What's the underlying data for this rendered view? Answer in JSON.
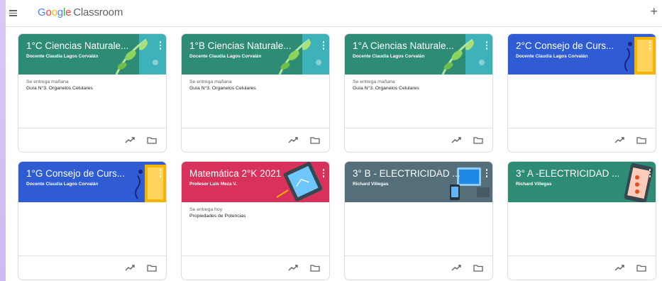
{
  "header": {
    "brand": {
      "g1": "G",
      "o1": "o",
      "o2": "o",
      "g2": "g",
      "l": "l",
      "e": "e",
      "product": "Classroom"
    },
    "add_label": "+"
  },
  "cards": [
    {
      "title": "1°C Ciencias Naturale...",
      "teacher": "Docente Claudia Lagos Corvalán",
      "color": "#2e8b74",
      "art": "leaf",
      "due": "Se entrega mañana",
      "assignment": "Guía N°3. Organelos Celulares"
    },
    {
      "title": "1°B Ciencias Naturale...",
      "teacher": "Docente Claudia Lagos Corvalán",
      "color": "#2e8b74",
      "art": "leaf",
      "due": "Se entrega mañana",
      "assignment": "Guía N°3. Organelos Celulares"
    },
    {
      "title": "1°A Ciencias Naturale...",
      "teacher": "Docente Claudia Lagos Corvalán",
      "color": "#2e8b74",
      "art": "leaf",
      "due": "Se entrega mañana",
      "assignment": "Guía N°3. Organelos Celulares"
    },
    {
      "title": "2°C Consejo de Curs...",
      "teacher": "Docente Claudia Lagos Corvalán",
      "color": "#2f5bd3",
      "art": "notebook",
      "due": "",
      "assignment": ""
    },
    {
      "title": "1°G Consejo de Curs...",
      "teacher": "Docente Claudia Lagos Corvalán",
      "color": "#2f5bd3",
      "art": "notebook",
      "due": "",
      "assignment": ""
    },
    {
      "title": "Matemática 2°K 2021",
      "teacher": "Profesor Luis Meza V.",
      "color": "#d8315b",
      "art": "tablet",
      "due": "Se entrega hoy",
      "assignment": "Propiedades de Potencias"
    },
    {
      "title": "3° B - ELECTRICIDAD ...",
      "teacher": "Richard Villegas",
      "color": "#546e7a",
      "art": "devices",
      "due": "",
      "assignment": ""
    },
    {
      "title": "3° A -ELECTRICIDAD ...",
      "teacher": "Richard Villegas",
      "color": "#2e8b74",
      "art": "phone",
      "due": "",
      "assignment": ""
    }
  ],
  "icons": {
    "menu": "hamburger-icon",
    "add": "plus-icon",
    "card_menu": "more-vert-icon",
    "trend": "trending-up-icon",
    "folder": "folder-icon"
  }
}
